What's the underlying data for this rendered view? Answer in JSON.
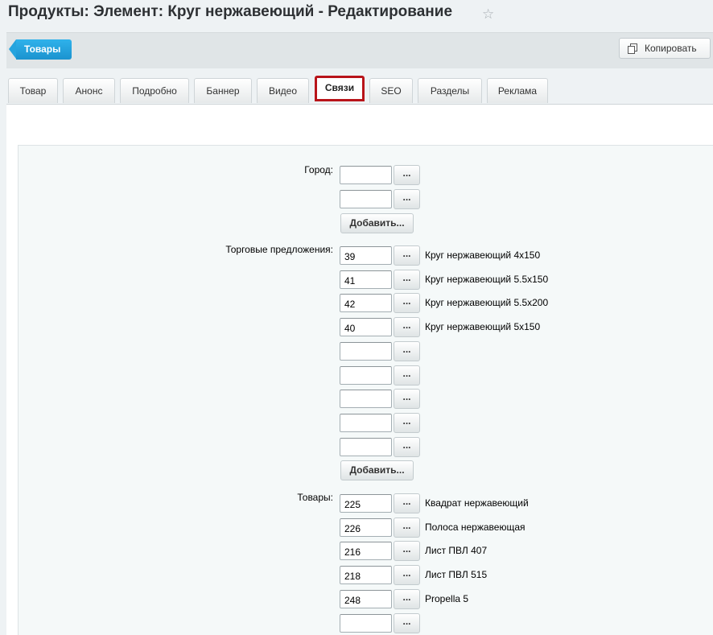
{
  "page": {
    "title": "Продукты: Элемент: Круг нержавеющий - Редактирование",
    "star_icon": "star-icon"
  },
  "toolbar": {
    "back_label": "Товары",
    "copy_label": "Копировать",
    "copy_icon": "copy-icon"
  },
  "tabs": [
    {
      "label": "Товар"
    },
    {
      "label": "Анонс"
    },
    {
      "label": "Подробно"
    },
    {
      "label": "Баннер"
    },
    {
      "label": "Видео"
    },
    {
      "label": "Связи",
      "active": true
    },
    {
      "label": "SEO"
    },
    {
      "label": "Разделы"
    },
    {
      "label": "Реклама"
    }
  ],
  "form": {
    "city": {
      "label": "Город:",
      "rows": [
        {
          "value": "",
          "name": ""
        },
        {
          "value": "",
          "name": ""
        }
      ],
      "add_label": "Добавить..."
    },
    "offers": {
      "label": "Торговые предложения:",
      "rows": [
        {
          "value": "39",
          "name": "Круг нержавеющий 4х150"
        },
        {
          "value": "41",
          "name": "Круг нержавеющий 5.5х150"
        },
        {
          "value": "42",
          "name": "Круг нержавеющий 5.5х200"
        },
        {
          "value": "40",
          "name": "Круг нержавеющий 5х150"
        },
        {
          "value": "",
          "name": ""
        },
        {
          "value": "",
          "name": ""
        },
        {
          "value": "",
          "name": ""
        },
        {
          "value": "",
          "name": ""
        },
        {
          "value": "",
          "name": ""
        }
      ],
      "add_label": "Добавить..."
    },
    "products": {
      "label": "Товары:",
      "rows": [
        {
          "value": "225",
          "name": "Квадрат нержавеющий"
        },
        {
          "value": "226",
          "name": "Полоса нержавеющая"
        },
        {
          "value": "216",
          "name": "Лист ПВЛ 407"
        },
        {
          "value": "218",
          "name": "Лист ПВЛ 515"
        },
        {
          "value": "248",
          "name": "Propella 5"
        },
        {
          "value": "",
          "name": ""
        }
      ]
    },
    "browse_label": "..."
  },
  "colors": {
    "accent": "#1b93cf",
    "active_tab_border": "#b8141a"
  }
}
